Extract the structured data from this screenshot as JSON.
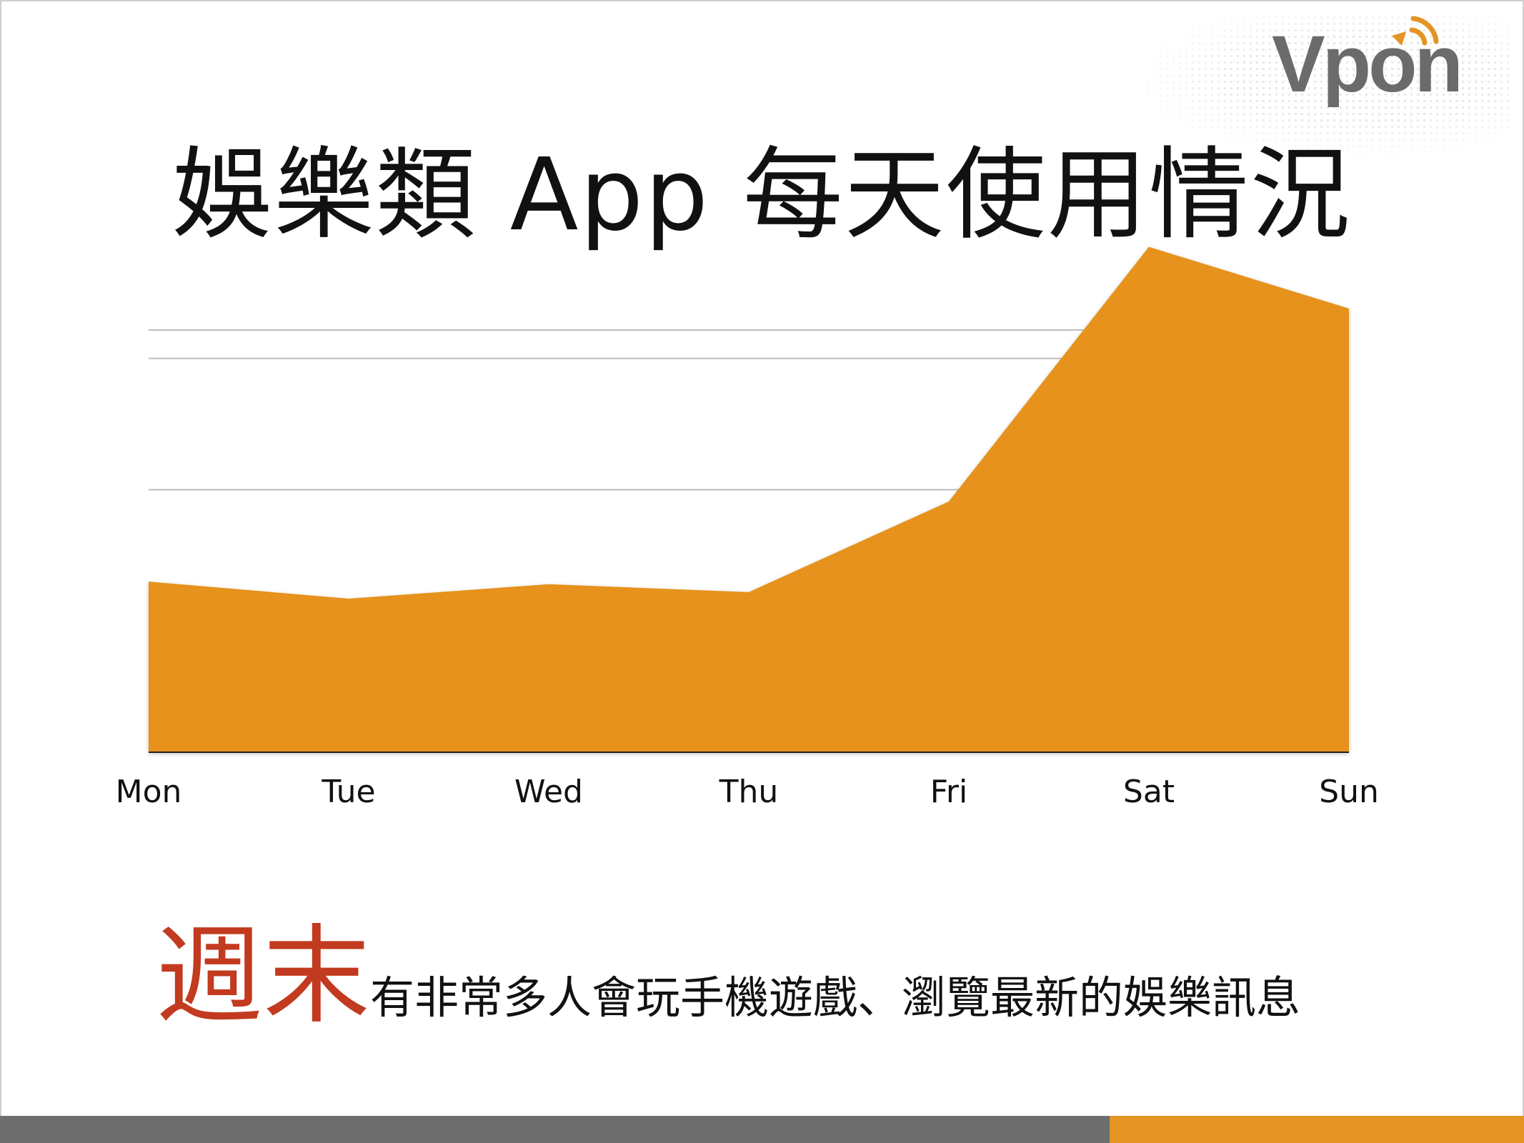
{
  "slide": {
    "title": "娛樂類 App 每天使用情況",
    "caption_emphasis": "週末",
    "caption_rest": "有非常多人會玩手機遊戲、瀏覽最新的娛樂訊息"
  },
  "logo": {
    "text": "Vpon",
    "icon": "vpon-logo"
  },
  "colors": {
    "area_fill": "#e6921f",
    "emphasis": "#c23a1f",
    "bar_dark": "#6e6e6e",
    "bar_accent": "#e49424"
  },
  "chart_data": {
    "type": "area",
    "categories": [
      "Mon",
      "Tue",
      "Wed",
      "Thu",
      "Fri",
      "Sat",
      "Sun"
    ],
    "values": [
      1.3,
      1.17,
      1.28,
      1.22,
      1.91,
      3.85,
      3.38
    ],
    "ylim": [
      0,
      4
    ],
    "grid": true,
    "y_tick_labels_shown": false
  }
}
